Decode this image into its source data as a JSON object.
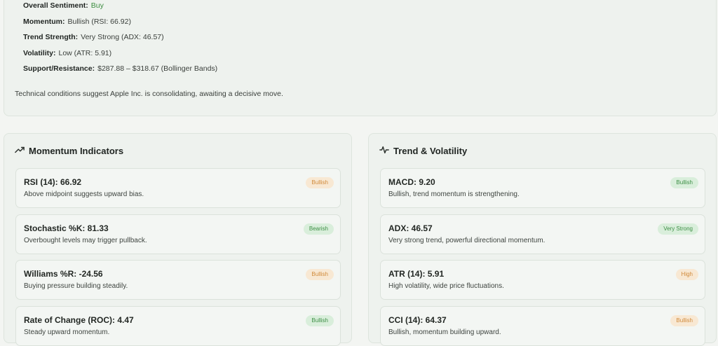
{
  "summary": {
    "overall_label": "Overall Sentiment:",
    "overall_value": "Buy",
    "momentum_label": "Momentum:",
    "momentum_value": "Bullish (RSI: 66.92)",
    "trend_label": "Trend Strength:",
    "trend_value": "Very Strong (ADX: 46.57)",
    "volatility_label": "Volatility:",
    "volatility_value": "Low (ATR: 5.91)",
    "sr_label": "Support/Resistance:",
    "sr_value": "$287.88 – $318.67 (Bollinger Bands)",
    "note": "Technical conditions suggest Apple Inc. is consolidating, awaiting a decisive move."
  },
  "momentum": {
    "title": "Momentum Indicators",
    "items": [
      {
        "name": "RSI (14): 66.92",
        "desc": "Above midpoint suggests upward bias.",
        "badge": "Bullish",
        "badge_color": "orange"
      },
      {
        "name": "Stochastic %K: 81.33",
        "desc": "Overbought levels may trigger pullback.",
        "badge": "Bearish",
        "badge_color": "green"
      },
      {
        "name": "Williams %R: -24.56",
        "desc": "Buying pressure building steadily.",
        "badge": "Bullish",
        "badge_color": "orange"
      },
      {
        "name": "Rate of Change (ROC): 4.47",
        "desc": "Steady upward momentum.",
        "badge": "Bullish",
        "badge_color": "green"
      }
    ]
  },
  "trend": {
    "title": "Trend & Volatility",
    "items": [
      {
        "name": "MACD: 9.20",
        "desc": "Bullish, trend momentum is strengthening.",
        "badge": "Bullish",
        "badge_color": "green"
      },
      {
        "name": "ADX: 46.57",
        "desc": "Very strong trend, powerful directional momentum.",
        "badge": "Very Strong",
        "badge_color": "green"
      },
      {
        "name": "ATR (14): 5.91",
        "desc": "High volatility, wide price fluctuations.",
        "badge": "High",
        "badge_color": "orange"
      },
      {
        "name": "CCI (14): 64.37",
        "desc": "Bullish, momentum building upward.",
        "badge": "Bullish",
        "badge_color": "orange"
      }
    ]
  },
  "colors": {
    "accent_green": "#3b8c3f",
    "badge_orange": "#d08a3a",
    "badge_green": "#3d8f45"
  }
}
